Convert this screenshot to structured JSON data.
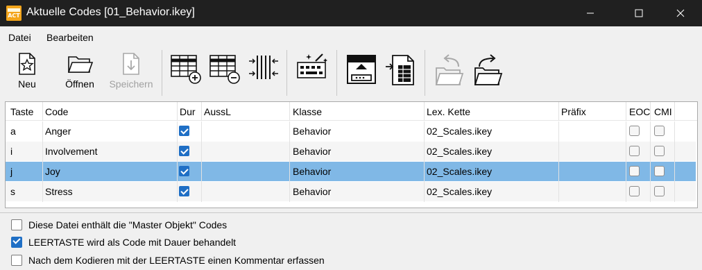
{
  "window": {
    "app_icon_text": "Interact",
    "title": "Aktuelle Codes [01_Behavior.ikey]"
  },
  "menu": {
    "items": [
      "Datei",
      "Bearbeiten"
    ]
  },
  "toolbar": {
    "new_label": "Neu",
    "open_label": "Öffnen",
    "save_label": "Speichern"
  },
  "table": {
    "columns": [
      "Taste",
      "Code",
      "Dur",
      "AussL",
      "Klasse",
      "Lex. Kette",
      "Präfix",
      "EOC",
      "CMI"
    ],
    "rows": [
      {
        "key": "a",
        "code": "Anger",
        "dur": true,
        "aussl": "",
        "klasse": "Behavior",
        "lex": "02_Scales.ikey",
        "praefix": "",
        "eoc": false,
        "cmi": false,
        "selected": false
      },
      {
        "key": "i",
        "code": "Involvement",
        "dur": true,
        "aussl": "",
        "klasse": "Behavior",
        "lex": "02_Scales.ikey",
        "praefix": "",
        "eoc": false,
        "cmi": false,
        "selected": false
      },
      {
        "key": "j",
        "code": "Joy",
        "dur": true,
        "aussl": "",
        "klasse": "Behavior",
        "lex": "02_Scales.ikey",
        "praefix": "",
        "eoc": false,
        "cmi": false,
        "selected": true
      },
      {
        "key": "s",
        "code": "Stress",
        "dur": true,
        "aussl": "",
        "klasse": "Behavior",
        "lex": "02_Scales.ikey",
        "praefix": "",
        "eoc": false,
        "cmi": false,
        "selected": false
      }
    ]
  },
  "options": [
    {
      "label": "Diese Datei enthält die \"Master Objekt\" Codes",
      "checked": false
    },
    {
      "label": "LEERTASTE wird als Code mit Dauer behandelt",
      "checked": true
    },
    {
      "label": "Nach dem Kodieren mit der LEERTASTE einen Kommentar erfassen",
      "checked": false
    }
  ],
  "colors": {
    "title_bar": "#202020",
    "selection": "#80b8e6",
    "checkbox_accent": "#1f6fc5",
    "app_icon": "#f3a51b"
  }
}
